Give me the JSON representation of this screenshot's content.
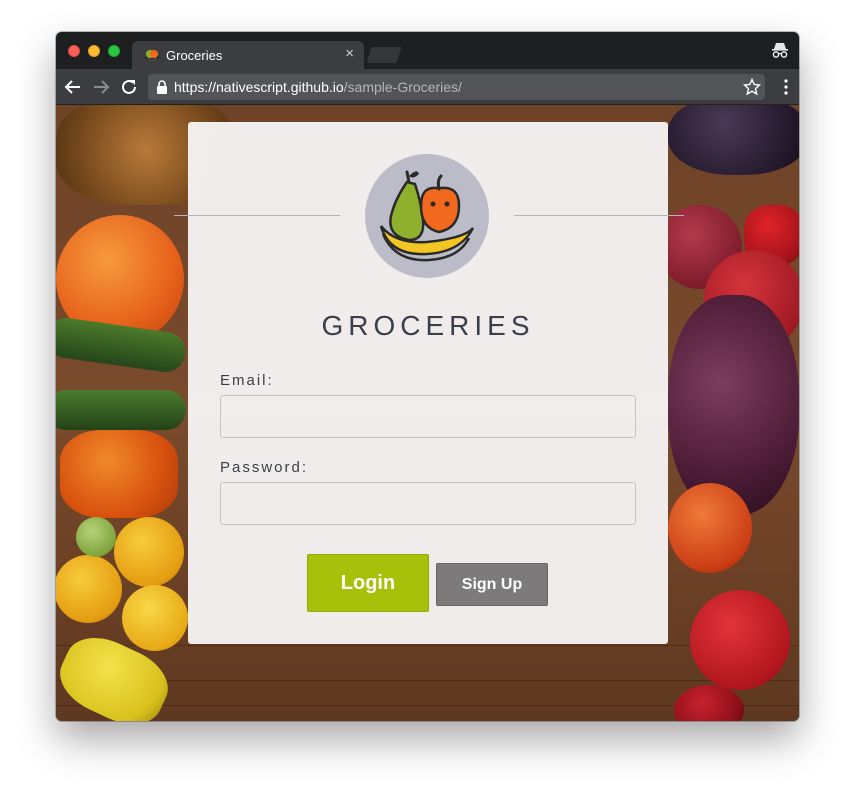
{
  "browser": {
    "tab_title": "Groceries",
    "tab_close": "×",
    "url_host": "https://nativescript.github.io",
    "url_path": "/sample-Groceries/"
  },
  "app": {
    "name": "GROCERIES",
    "email_label": "Email:",
    "email_value": "",
    "password_label": "Password:",
    "password_value": "",
    "login_label": "Login",
    "signup_label": "Sign Up"
  },
  "colors": {
    "accent": "#a7c00a",
    "secondary_button": "#7d7a7b",
    "logo_circle": "#bcbcc9"
  }
}
